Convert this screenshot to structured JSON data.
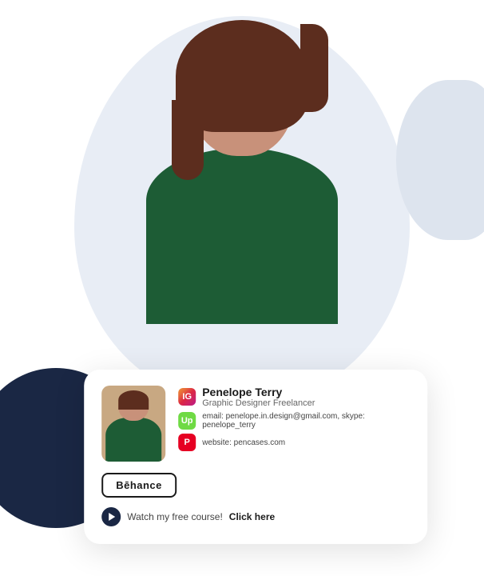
{
  "person": {
    "name": "Penelope Terry",
    "role": "Graphic Designer Freelancer",
    "email": "penelope.in.design@gmail.com",
    "skype": "penelope_terry",
    "website": "pencases.com"
  },
  "card": {
    "name_label": "Penelope Terry",
    "role_label": "Graphic Designer Freelancer",
    "contact_label": "email: penelope.in.design@gmail.com, skype: penelope_terry",
    "website_label": "website: pencases.com",
    "behance_btn": "Bēhance",
    "course_text": "Watch my free course!",
    "course_link": "Click here"
  },
  "icons": {
    "instagram": "IG",
    "upwork": "Up",
    "pinterest": "P"
  }
}
